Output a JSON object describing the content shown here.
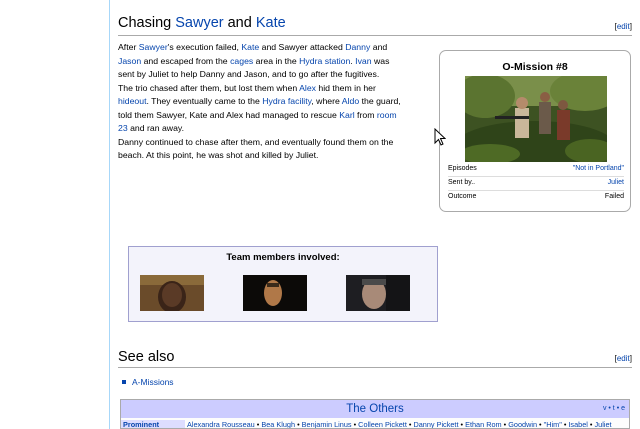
{
  "section_chasing": {
    "title_prefix": "Chasing ",
    "title_link1": "Sawyer",
    "title_and": " and ",
    "title_link2": "Kate",
    "edit_open": "[",
    "edit_label": "edit",
    "edit_close": "]"
  },
  "paragraph": {
    "p1": [
      {
        "t": "After ",
        "link": false
      },
      {
        "t": "Sawyer",
        "link": true
      },
      {
        "t": "'s execution failed, ",
        "link": false
      },
      {
        "t": "Kate",
        "link": true
      },
      {
        "t": " and Sawyer attacked ",
        "link": false
      },
      {
        "t": "Danny",
        "link": true
      },
      {
        "t": " and ",
        "link": false
      },
      {
        "t": "Jason",
        "link": true
      },
      {
        "t": " and escaped from the ",
        "link": false
      },
      {
        "t": "cages",
        "link": true
      },
      {
        "t": " area in the ",
        "link": false
      },
      {
        "t": "Hydra station",
        "link": true
      },
      {
        "t": ". ",
        "link": false
      },
      {
        "t": "Ivan",
        "link": true
      },
      {
        "t": " was sent by Juliet to help Danny and Jason, and to go after the fugitives.",
        "link": false
      }
    ],
    "p2": [
      {
        "t": "The trio chased after them, but lost them when ",
        "link": false
      },
      {
        "t": "Alex",
        "link": true
      },
      {
        "t": " hid them in her ",
        "link": false
      },
      {
        "t": "hideout",
        "link": true
      },
      {
        "t": ". They eventually came to the ",
        "link": false
      },
      {
        "t": "Hydra facility",
        "link": true
      },
      {
        "t": ", where ",
        "link": false
      },
      {
        "t": "Aldo",
        "link": true
      },
      {
        "t": " the guard, told them Sawyer, Kate and Alex had managed to rescue ",
        "link": false
      },
      {
        "t": "Karl",
        "link": true
      },
      {
        "t": " from ",
        "link": false
      },
      {
        "t": "room 23",
        "link": true
      },
      {
        "t": " and ran away.",
        "link": false
      }
    ],
    "p3": [
      {
        "t": "Danny continued to chase after them, and eventually found them on the beach. At this point, he was shot and killed by Juliet.",
        "link": false
      }
    ]
  },
  "infobox": {
    "title": "O-Mission #8",
    "rows": [
      {
        "label": "Episodes",
        "value": "\"Not in Portland\"",
        "link": true
      },
      {
        "label": "Sent by..",
        "value": "Juliet",
        "link": true
      },
      {
        "label": "Outcome",
        "value": "Failed",
        "link": false
      }
    ]
  },
  "team": {
    "title": "Team members involved:"
  },
  "section_seealso": {
    "title": "See also",
    "edit_open": "[",
    "edit_label": "edit",
    "edit_close": "]",
    "items": [
      "A-Missions"
    ]
  },
  "navbox": {
    "title": "The Others",
    "vte": [
      "v",
      "t",
      "e"
    ],
    "group": "Prominent",
    "members": [
      "Alexandra Rousseau",
      "Bea Klugh",
      "Benjamin Linus",
      "Colleen Pickett",
      "Danny Pickett",
      "Ethan Rom",
      "Goodwin",
      "\"Him\"",
      "Isabel",
      "Juliet"
    ],
    "separator": " • "
  },
  "colors": {
    "link": "#0645ad",
    "navbox_header": "#ccccff",
    "team_bg": "#f3f3fb"
  }
}
